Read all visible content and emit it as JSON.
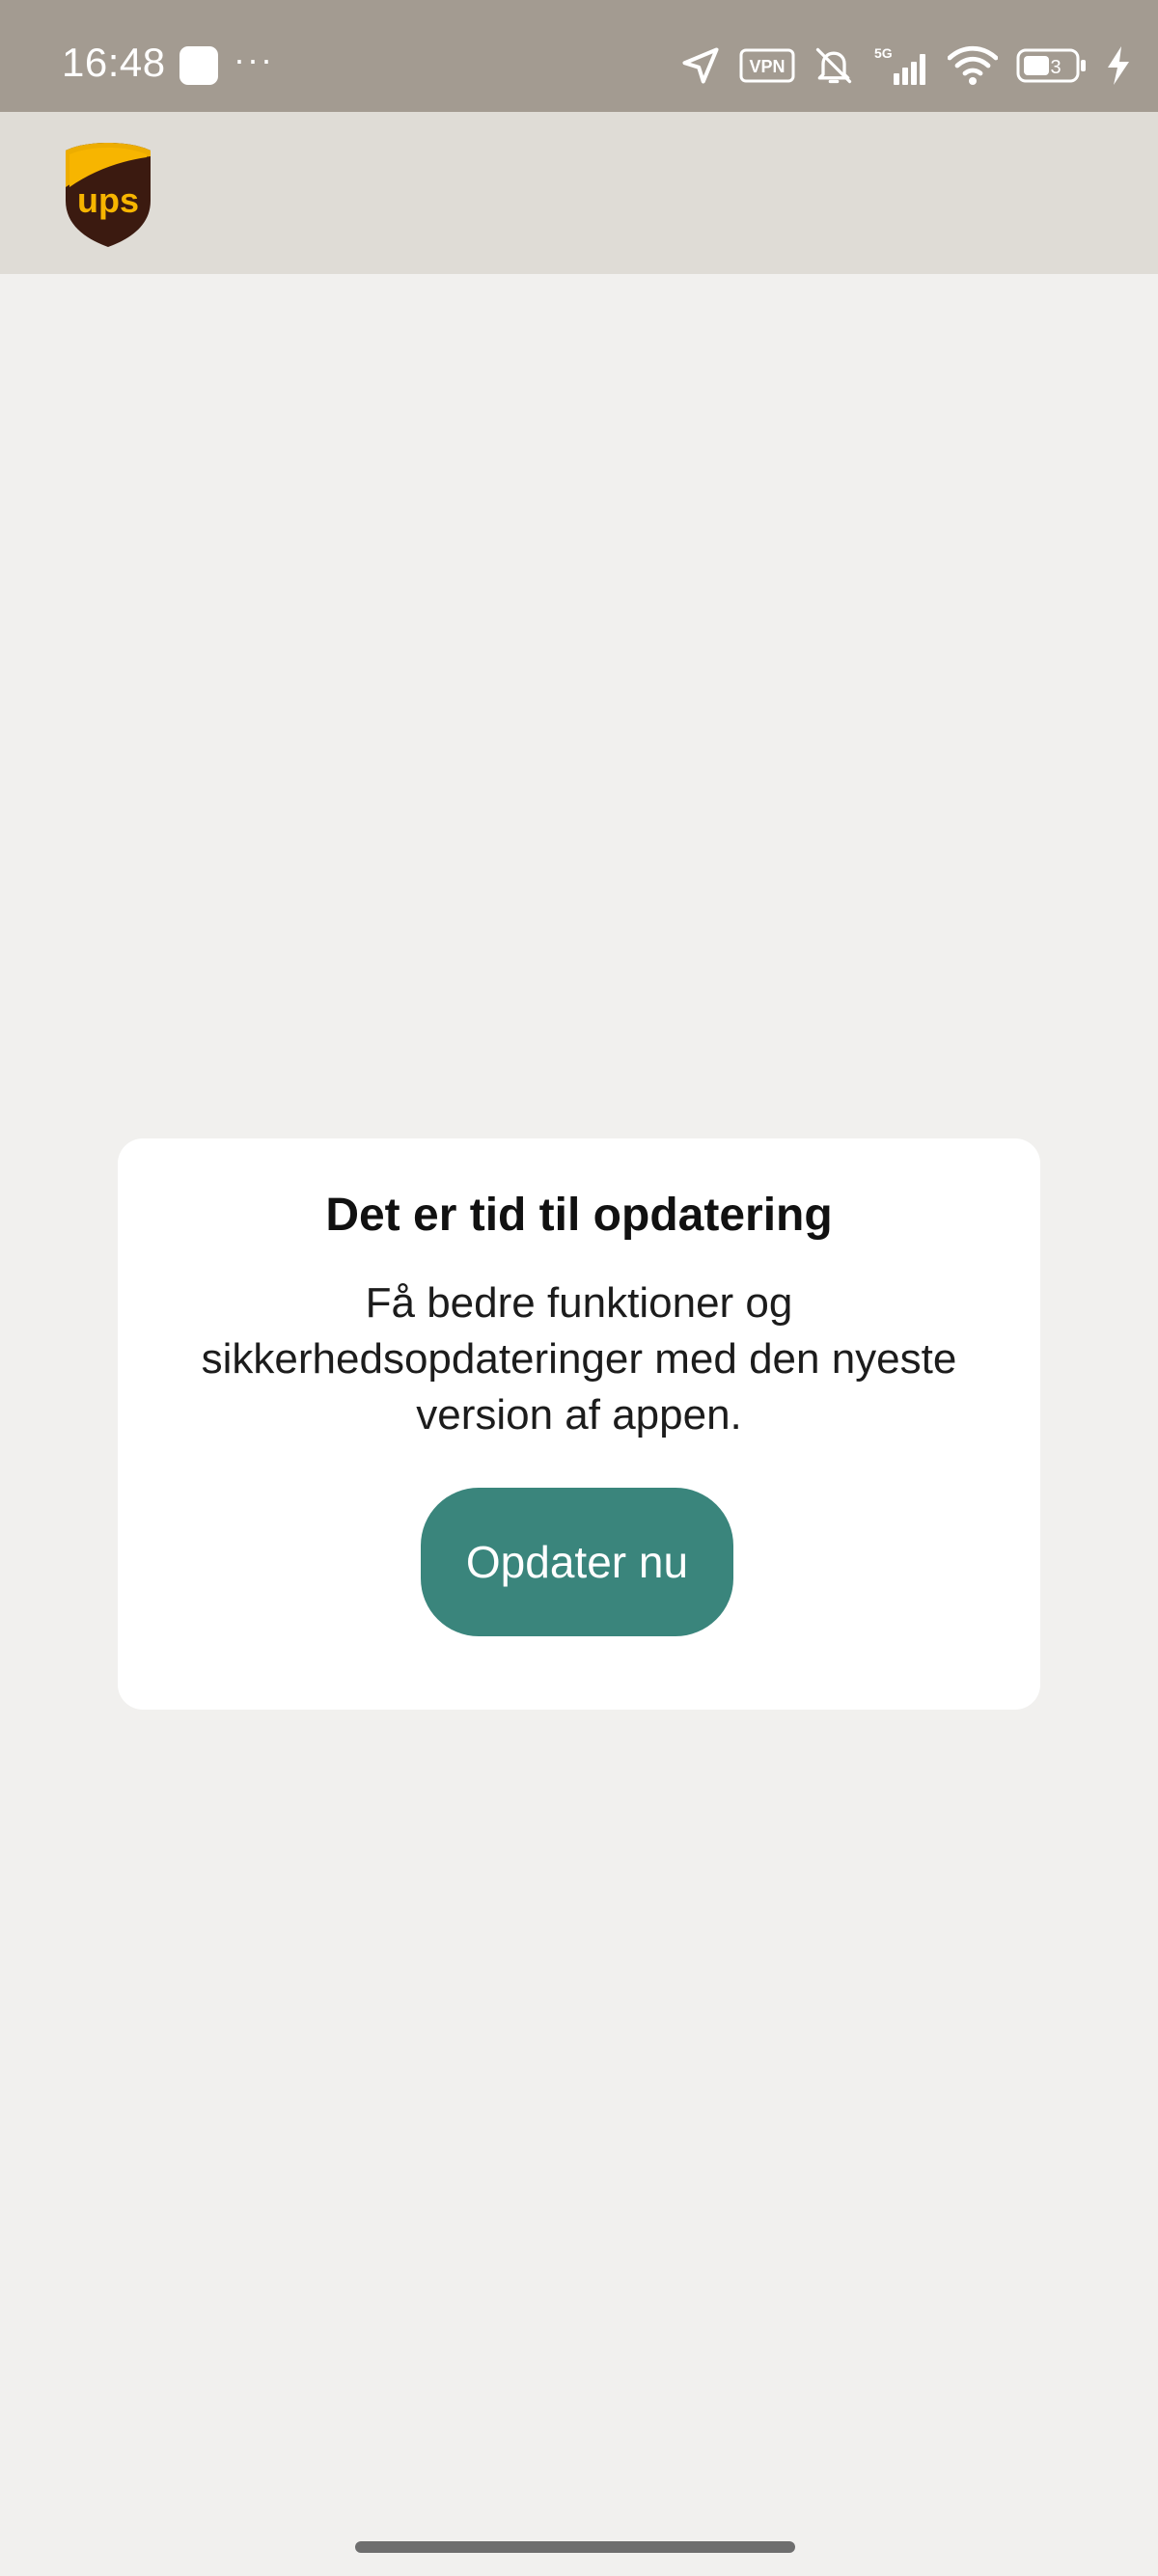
{
  "status_bar": {
    "time": "16:48",
    "overflow": "···",
    "icons": [
      "location-arrow-icon",
      "vpn-icon",
      "bell-muted-icon",
      "signal-5g-icon",
      "wifi-icon",
      "battery-icon",
      "charging-bolt-icon"
    ],
    "vpn_label": "VPN",
    "network_label": "5G",
    "battery_level": "3"
  },
  "header": {
    "logo_text": "ups",
    "logo_colors": {
      "shield": "#3b1a10",
      "accent": "#f7b500"
    },
    "background": "#dfdcd6"
  },
  "dialog": {
    "title": "Det er tid til opdatering",
    "body_lines": [
      "Få bedre funktioner og",
      "sikkerhedsopdateringer med den nyeste",
      "version af appen."
    ],
    "button_label": "Opdater nu",
    "button_color": "#3a857c"
  },
  "colors": {
    "status_bar": "#a39b91",
    "page_background": "#f1f0ee"
  }
}
